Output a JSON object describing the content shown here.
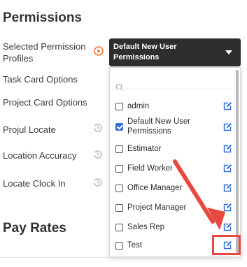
{
  "section": {
    "title": "Permissions"
  },
  "pay_rates": {
    "title": "Pay Rates"
  },
  "settings": {
    "selected_profiles_label": "Selected Permission Profiles",
    "task_card_label": "Task Card Options",
    "project_card_label": "Project Card Options",
    "projul_locate_label": "Projul Locate",
    "location_accuracy_label": "Location Accuracy",
    "locate_clock_in_label": "Locate Clock In"
  },
  "select": {
    "value": "Default New User Permissions"
  },
  "dropdown": {
    "search_placeholder": "",
    "items": [
      {
        "label": "admin",
        "checked": false
      },
      {
        "label": "Default New User Permissions",
        "checked": true
      },
      {
        "label": "Estimator",
        "checked": false
      },
      {
        "label": "Field Worker",
        "checked": false
      },
      {
        "label": "Office Manager",
        "checked": false
      },
      {
        "label": "Project Manager",
        "checked": false
      },
      {
        "label": "Sales Rep",
        "checked": false
      },
      {
        "label": "Test",
        "checked": false
      }
    ]
  },
  "colors": {
    "accent_blue": "#2f6fd1",
    "select_bg": "#2e2e2e",
    "play_orange": "#ea7a2e",
    "annotation_red": "#e8493f"
  }
}
